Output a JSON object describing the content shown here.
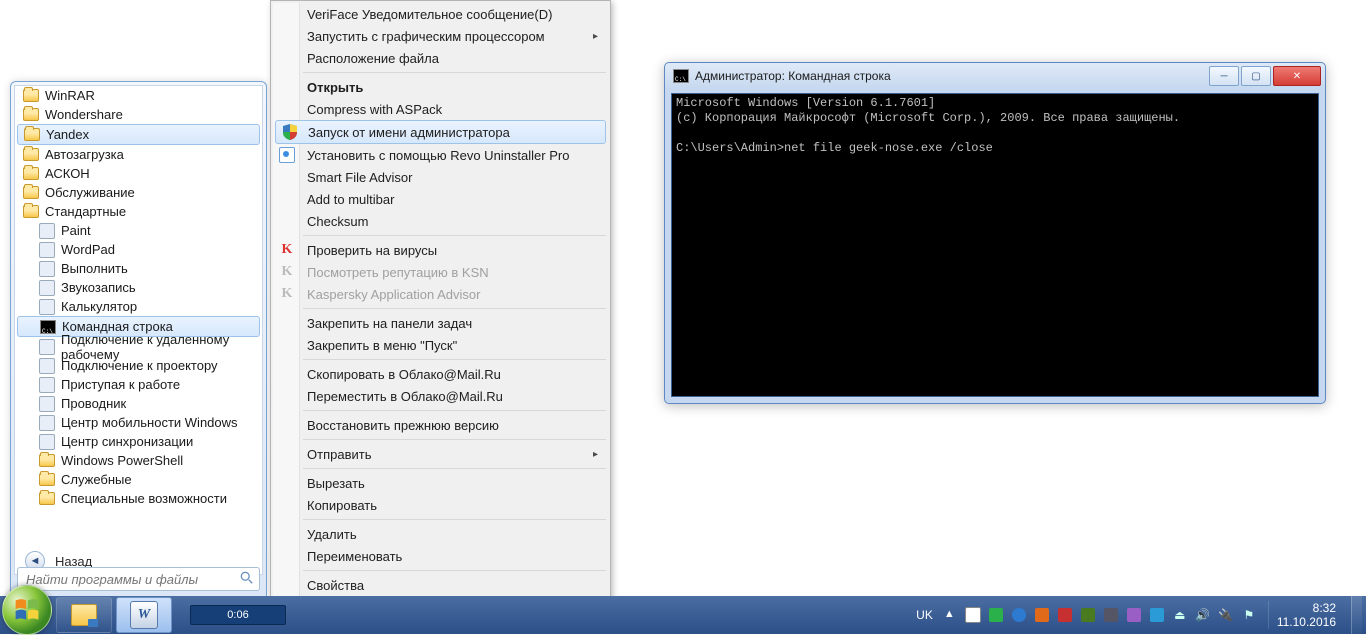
{
  "start_menu": {
    "items": [
      {
        "label": "WinRAR",
        "kind": "folder",
        "indent": false
      },
      {
        "label": "Wondershare",
        "kind": "folder",
        "indent": false
      },
      {
        "label": "Yandex",
        "kind": "folder",
        "indent": false,
        "highlight": true
      },
      {
        "label": "Автозагрузка",
        "kind": "folder",
        "indent": false
      },
      {
        "label": "АСКОН",
        "kind": "folder",
        "indent": false
      },
      {
        "label": "Обслуживание",
        "kind": "folder",
        "indent": false
      },
      {
        "label": "Стандартные",
        "kind": "folder",
        "indent": false
      },
      {
        "label": "Paint",
        "kind": "app",
        "indent": true
      },
      {
        "label": "WordPad",
        "kind": "app",
        "indent": true
      },
      {
        "label": "Выполнить",
        "kind": "app",
        "indent": true
      },
      {
        "label": "Звукозапись",
        "kind": "app",
        "indent": true
      },
      {
        "label": "Калькулятор",
        "kind": "app",
        "indent": true
      },
      {
        "label": "Командная строка",
        "kind": "cmd",
        "indent": true,
        "highlight": true
      },
      {
        "label": "Подключение к удаленному рабочему",
        "kind": "app",
        "indent": true
      },
      {
        "label": "Подключение к проектору",
        "kind": "app",
        "indent": true
      },
      {
        "label": "Приступая к работе",
        "kind": "app",
        "indent": true
      },
      {
        "label": "Проводник",
        "kind": "app",
        "indent": true
      },
      {
        "label": "Центр мобильности Windows",
        "kind": "app",
        "indent": true
      },
      {
        "label": "Центр синхронизации",
        "kind": "app",
        "indent": true
      },
      {
        "label": "Windows PowerShell",
        "kind": "folder",
        "indent": true
      },
      {
        "label": "Служебные",
        "kind": "folder",
        "indent": true
      },
      {
        "label": "Специальные возможности",
        "kind": "folder",
        "indent": true
      }
    ],
    "back_label": "Назад",
    "search_placeholder": "Найти программы и файлы"
  },
  "context_menu": {
    "groups": [
      [
        {
          "label": "VeriFace Уведомительное сообщение(D)"
        },
        {
          "label": "Запустить с графическим процессором",
          "submenu": true
        },
        {
          "label": "Расположение файла"
        }
      ],
      [
        {
          "label": "Открыть",
          "bold": true
        },
        {
          "label": "Compress with ASPack"
        },
        {
          "label": "Запуск от имени администратора",
          "icon": "shield",
          "highlight": true
        },
        {
          "label": "Установить с помощью Revo Uninstaller Pro",
          "icon": "revo"
        },
        {
          "label": "Smart File Advisor"
        },
        {
          "label": "Add to multibar"
        },
        {
          "label": "Checksum"
        }
      ],
      [
        {
          "label": "Проверить на вирусы",
          "icon": "kasp"
        },
        {
          "label": "Посмотреть репутацию в KSN",
          "icon": "kasp-dim",
          "disabled": true
        },
        {
          "label": "Kaspersky Application Advisor",
          "icon": "kasp-dim",
          "disabled": true
        }
      ],
      [
        {
          "label": "Закрепить на панели задач"
        },
        {
          "label": "Закрепить в меню \"Пуск\""
        }
      ],
      [
        {
          "label": "Скопировать в Облако@Mail.Ru"
        },
        {
          "label": "Переместить в Облако@Mail.Ru"
        }
      ],
      [
        {
          "label": "Восстановить прежнюю версию"
        }
      ],
      [
        {
          "label": "Отправить",
          "submenu": true
        }
      ],
      [
        {
          "label": "Вырезать"
        },
        {
          "label": "Копировать"
        }
      ],
      [
        {
          "label": "Удалить"
        },
        {
          "label": "Переименовать"
        }
      ],
      [
        {
          "label": "Свойства"
        }
      ]
    ]
  },
  "cmd_window": {
    "title": "Администратор: Командная строка",
    "line1": "Microsoft Windows [Version 6.1.7601]",
    "line2": "(c) Корпорация Майкрософт (Microsoft Corp.), 2009. Все права защищены.",
    "prompt": "C:\\Users\\Admin>",
    "cmd": "net file geek-nose.exe /close"
  },
  "taskbar": {
    "progress_text": "0:06",
    "language": "UK",
    "time": "8:32",
    "date": "11.10.2016",
    "tray_icons": [
      "chevron",
      "network",
      "kaspersky",
      "teamviewer",
      "orange",
      "disk",
      "nvidia",
      "tool1",
      "tool2",
      "clock-app",
      "eject",
      "volume",
      "power",
      "flag"
    ]
  }
}
